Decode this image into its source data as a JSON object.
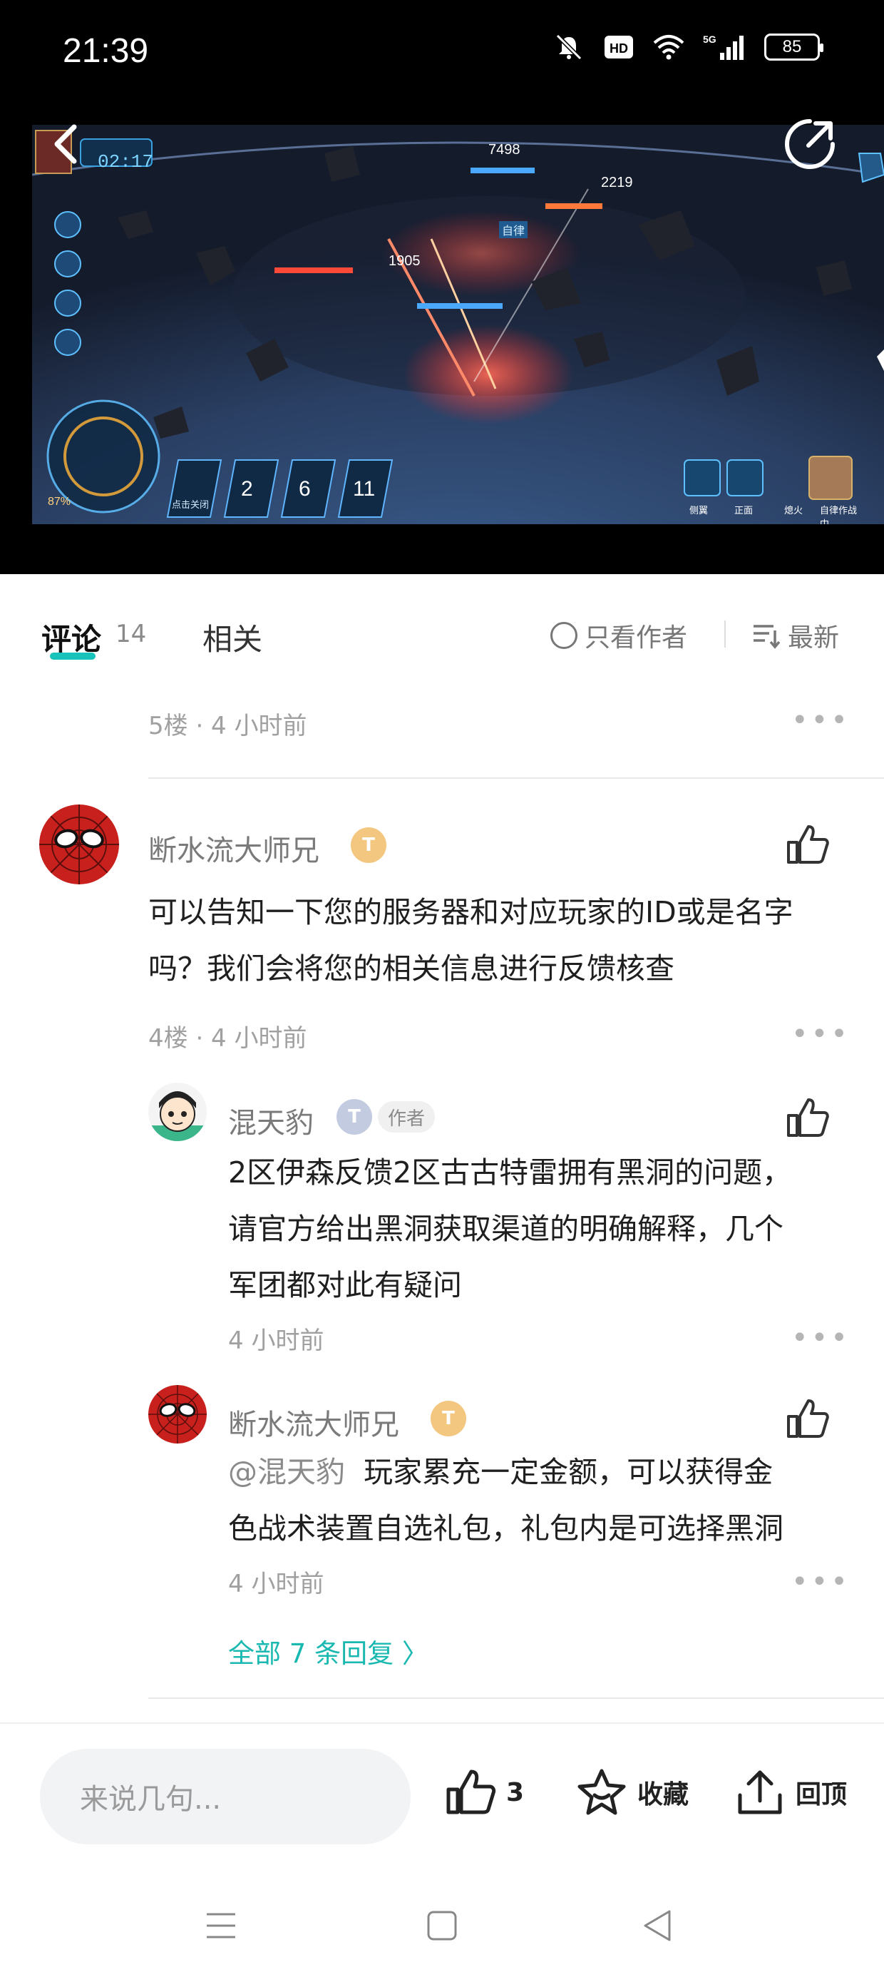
{
  "status_bar": {
    "time": "21:39",
    "battery": "85"
  },
  "video": {
    "timer": "02:17",
    "damage_1": "7498",
    "damage_2": "2219",
    "damage_3": "1905",
    "tag_auto": "自律",
    "unit_counts": [
      "2",
      "6",
      "11"
    ],
    "skill_labels": [
      "侧翼",
      "正面",
      "熄火",
      "自律作战中……"
    ],
    "power_pct": "87%",
    "slot_label": "点击关闭"
  },
  "tabs": {
    "comments_label": "评论",
    "comments_count": "14",
    "related_label": "相关",
    "only_author_label": "只看作者",
    "sort_label": "最新"
  },
  "comments": {
    "top_meta": "5楼 · 4 小时前",
    "main": {
      "username": "断水流大师兄",
      "badge": "T",
      "text_line1": "可以告知一下您的服务器和对应玩家的ID或是名字",
      "text_line2": "吗？我们会将您的相关信息进行反馈核查",
      "meta": "4楼 · 4 小时前"
    },
    "replies": [
      {
        "username": "混天豹",
        "badge": "T",
        "author_tag": "作者",
        "text_line1": "2区伊森反馈2区古古特雷拥有黑洞的问题，",
        "text_line2": "请官方给出黑洞获取渠道的明确解释，几个",
        "text_line3": "军团都对此有疑问",
        "time": "4 小时前"
      },
      {
        "username": "断水流大师兄",
        "badge": "T",
        "mention": "@混天豹",
        "text_line1": "玩家累充一定金额，可以获得金",
        "text_line2": "色战术装置自选礼包，礼包内是可选择黑洞",
        "time": "4 小时前"
      }
    ],
    "all_replies": "全部 7 条回复 〉"
  },
  "bottom_bar": {
    "input_placeholder": "来说几句...",
    "like_count": "3",
    "favorite_label": "收藏",
    "top_label": "回顶"
  },
  "colors": {
    "accent": "#19c2bb",
    "meta_gray": "#a0a0a0"
  },
  "icons": [
    "back-icon",
    "share-icon",
    "like-icon",
    "star-icon",
    "upload-icon",
    "menu-icon",
    "square-icon",
    "triangle-back-icon"
  ]
}
